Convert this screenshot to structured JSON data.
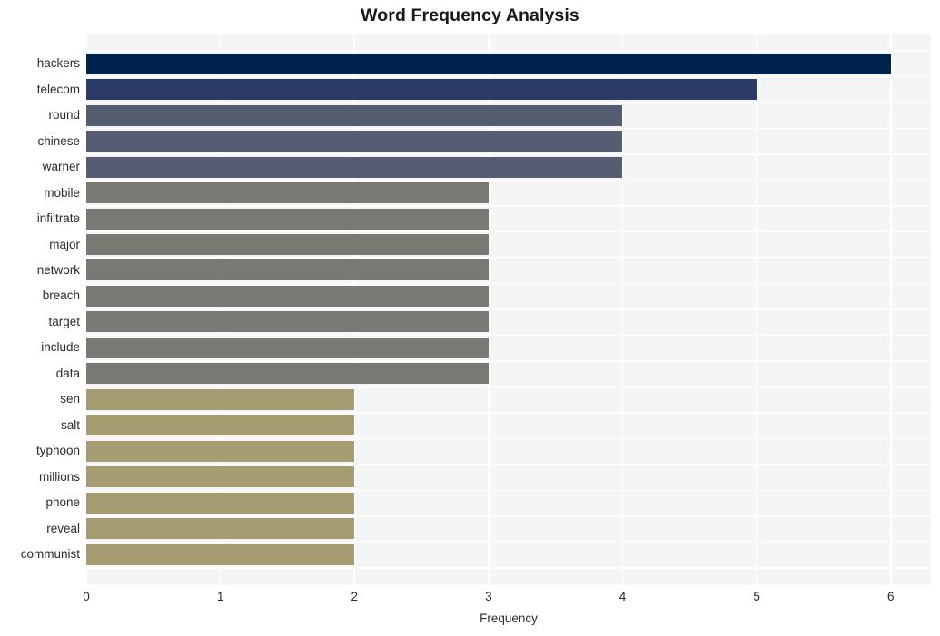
{
  "chart_data": {
    "type": "bar",
    "orientation": "horizontal",
    "title": "Word Frequency Analysis",
    "xlabel": "Frequency",
    "ylabel": "",
    "xlim": [
      0,
      6.3
    ],
    "xticks": [
      0,
      1,
      2,
      3,
      4,
      5,
      6
    ],
    "xtick_labels": [
      "0",
      "1",
      "2",
      "3",
      "4",
      "5",
      "6"
    ],
    "grid": true,
    "grid_color": "#ffffff",
    "plot_background": "#f5f5f6",
    "figure_background": "#ffffff",
    "legend": null,
    "categories": [
      "hackers",
      "telecom",
      "round",
      "chinese",
      "warner",
      "mobile",
      "infiltrate",
      "major",
      "network",
      "breach",
      "target",
      "include",
      "data",
      "sen",
      "salt",
      "typhoon",
      "millions",
      "phone",
      "reveal",
      "communist"
    ],
    "values": [
      6,
      5,
      4,
      4,
      4,
      3,
      3,
      3,
      3,
      3,
      3,
      3,
      3,
      2,
      2,
      2,
      2,
      2,
      2,
      2
    ],
    "bar_colors": [
      "#00224e",
      "#2c3b68",
      "#565c72",
      "#565c72",
      "#565c72",
      "#7a7872",
      "#7a7872",
      "#7a7872",
      "#7a7872",
      "#7a7872",
      "#7a7872",
      "#7a7872",
      "#7a7872",
      "#a59c72",
      "#a59c72",
      "#a59c72",
      "#a59c72",
      "#a59c72",
      "#a59c72",
      "#a59c72"
    ]
  }
}
